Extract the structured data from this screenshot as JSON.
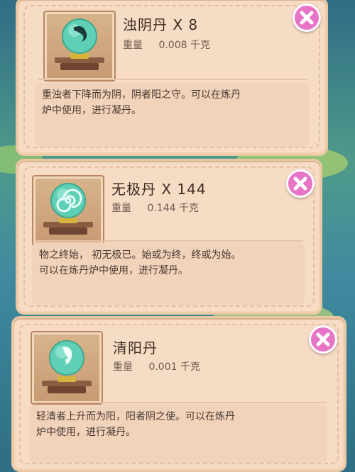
{
  "items": [
    {
      "name": "浊阴丹",
      "qty_text": "X 8",
      "weight_label": "重量",
      "weight_value": "0.008 千克",
      "desc_line1": "重浊者下降而为阴，阴者阳之守。可以在炼丹",
      "desc_line2": "炉中使用，进行凝丹。",
      "icon": "yin-orb-icon",
      "swirl_color": "#1d3a3a"
    },
    {
      "name": "无极丹",
      "qty_text": "X 144",
      "weight_label": "重量",
      "weight_value": "0.144 千克",
      "desc_line1": "物之终始， 初无极已。始或为终，终或为始。",
      "desc_line2": "可以在炼丹炉中使用，进行凝丹。",
      "icon": "spiral-orb-icon",
      "swirl_color": "#e8fff8"
    },
    {
      "name": "清阳丹",
      "qty_text": "",
      "weight_label": "重量",
      "weight_value": "0.001 千克",
      "desc_line1": "轻清者上升而为阳，阳者阴之使。可以在炼丹",
      "desc_line2": "炉中使用，进行凝丹。",
      "icon": "yang-orb-icon",
      "swirl_color": "#f4fffb"
    }
  ],
  "close_icon": "close-icon",
  "colors": {
    "accent": "#e874c6",
    "panel": "#f6dcc5",
    "orb": "#5fcfb6"
  }
}
